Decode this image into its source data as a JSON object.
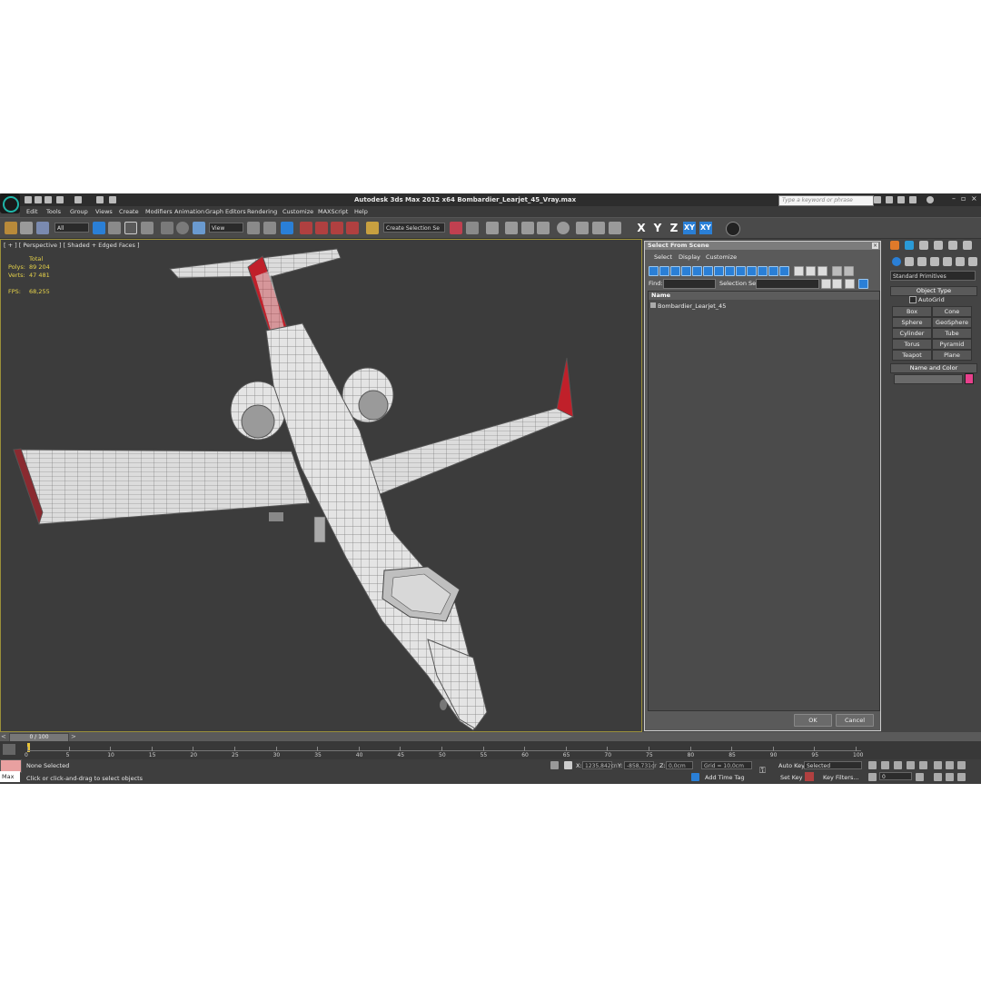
{
  "window": {
    "title": "Autodesk 3ds Max  2012 x64     Bombardier_Learjet_45_Vray.max",
    "search_placeholder": "Type a keyword or phrase"
  },
  "menus": [
    "Edit",
    "Tools",
    "Group",
    "Views",
    "Create",
    "Modifiers",
    "Animation",
    "Graph Editors",
    "Rendering",
    "Customize",
    "MAXScript",
    "Help"
  ],
  "toolbar": {
    "filter_value": "All",
    "coord_value": "View",
    "selection_set_value": "Create Selection Se",
    "axes": [
      "X",
      "Y",
      "Z",
      "XY",
      "XY"
    ]
  },
  "viewport": {
    "label": "[ + ] [ Perspective ] [ Shaded + Edged Faces ]",
    "stats": {
      "total_label": "Total",
      "polys_label": "Polys:",
      "polys_value": "89 204",
      "verts_label": "Verts:",
      "verts_value": "47 481",
      "fps_label": "FPS:",
      "fps_value": "68,255"
    }
  },
  "dialog": {
    "title": "Select From Scene",
    "menu": [
      "Select",
      "Display",
      "Customize"
    ],
    "find_label": "Find:",
    "selection_set_label": "Selection Set:",
    "column_name": "Name",
    "items": [
      "Bombardier_Learjet_45"
    ],
    "ok_label": "OK",
    "cancel_label": "Cancel"
  },
  "command_panel": {
    "category": "Standard Primitives",
    "object_type_title": "Object Type",
    "autogrid_label": "AutoGrid",
    "buttons": [
      "Box",
      "Cone",
      "Sphere",
      "GeoSphere",
      "Cylinder",
      "Tube",
      "Torus",
      "Pyramid",
      "Teapot",
      "Plane"
    ],
    "name_color_title": "Name and Color",
    "color_swatch": "#e8408c"
  },
  "timeline": {
    "slider_label": "0 / 100",
    "ticks": [
      "0",
      "5",
      "10",
      "15",
      "20",
      "25",
      "30",
      "35",
      "40",
      "45",
      "50",
      "55",
      "60",
      "65",
      "70",
      "75",
      "80",
      "85",
      "90",
      "95",
      "100"
    ]
  },
  "status": {
    "selection": "None Selected",
    "prompt": "Click or click-and-drag to select objects",
    "maxscript_label": "Max",
    "x_label": "X:",
    "x_value": "1235,842cn",
    "y_label": "Y:",
    "y_value": "-858,731cr",
    "z_label": "Z:",
    "z_value": "0,0cm",
    "grid": "Grid = 10,0cm",
    "add_time_tag": "Add Time Tag",
    "auto_key": "Auto Key",
    "set_key": "Set Key",
    "key_mode_value": "Selected",
    "key_filters": "Key Filters...",
    "frame_value": "0"
  },
  "colors": {
    "accent_blue": "#2a7fd6",
    "viewport_border": "#9a8f3a",
    "stats_yellow": "#e8d44a",
    "livery_red": "#c0202a"
  }
}
